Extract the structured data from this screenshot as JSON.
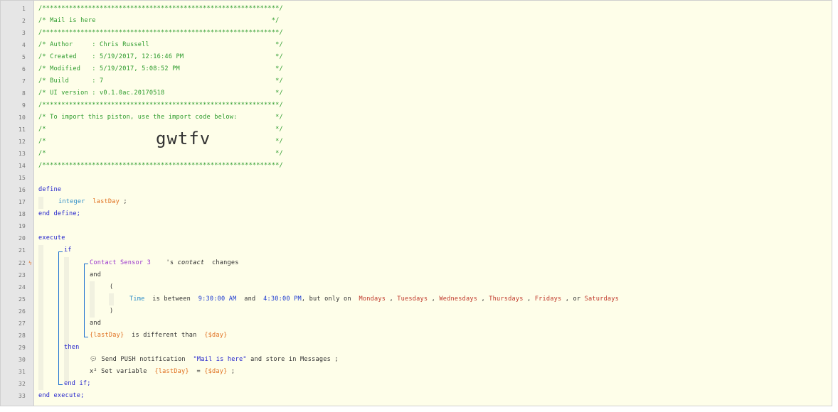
{
  "lines": [
    {
      "n": "1",
      "text": "/**************************************************************/"
    },
    {
      "n": "2",
      "text": "/* Mail is here                                              */"
    },
    {
      "n": "3",
      "text": "/**************************************************************/"
    },
    {
      "n": "4",
      "text": "/* Author     : Chris Russell                                 */"
    },
    {
      "n": "5",
      "text": "/* Created    : 5/19/2017, 12:16:46 PM                        */"
    },
    {
      "n": "6",
      "text": "/* Modified   : 5/19/2017, 5:08:52 PM                         */"
    },
    {
      "n": "7",
      "text": "/* Build      : 7                                             */"
    },
    {
      "n": "8",
      "text": "/* UI version : v0.1.0ac.20170518                             */"
    },
    {
      "n": "9",
      "text": "/**************************************************************/"
    },
    {
      "n": "10",
      "text": "/* To import this piston, use the import code below:          */"
    },
    {
      "n": "11",
      "text": "/*                                                            */"
    },
    {
      "n": "12",
      "text": "/*                                                            */"
    },
    {
      "n": "13",
      "text": "/*                                                            */"
    },
    {
      "n": "14",
      "text": "/**************************************************************/"
    },
    {
      "n": "15"
    },
    {
      "n": "16"
    },
    {
      "n": "17"
    },
    {
      "n": "18"
    },
    {
      "n": "19"
    },
    {
      "n": "20"
    },
    {
      "n": "21"
    },
    {
      "n": "22"
    },
    {
      "n": "23"
    },
    {
      "n": "24"
    },
    {
      "n": "25"
    },
    {
      "n": "26"
    },
    {
      "n": "27"
    },
    {
      "n": "28"
    },
    {
      "n": "29"
    },
    {
      "n": "30"
    },
    {
      "n": "31"
    },
    {
      "n": "32"
    },
    {
      "n": "33"
    }
  ],
  "import_code": "gwtfv",
  "kw": {
    "define": "define",
    "end_define": "end define;",
    "execute": "execute",
    "if": "if",
    "and": "and",
    "then": "then",
    "end_if": "end if;",
    "end_execute": "end execute;",
    "open_paren": "(",
    "close_paren": ")"
  },
  "define_var": {
    "type": "integer",
    "name": "lastDay",
    "semi": ";"
  },
  "cond1": {
    "device": "Contact Sensor 3",
    "poss": "'s",
    "attr": "contact",
    "op": "changes"
  },
  "cond2": {
    "subject": "Time",
    "op": "is between",
    "t1": "9:30:00 AM",
    "and": "and",
    "t2": "4:30:00 PM",
    "filter": ", but only on",
    "days": [
      "Mondays",
      "Tuesdays",
      "Wednesdays",
      "Thursdays",
      "Fridays",
      "Saturdays"
    ],
    "or": "or"
  },
  "cond3": {
    "left": "{lastDay}",
    "op": "is different than",
    "right": "{$day}"
  },
  "action1": {
    "verb": "Send PUSH notification",
    "msg": "\"Mail is here\"",
    "store": "and store in Messages",
    "semi": ";"
  },
  "action2": {
    "verb": "Set variable",
    "var": "{lastDay}",
    "eq": "=",
    "val": "{$day}",
    "semi": ";"
  }
}
